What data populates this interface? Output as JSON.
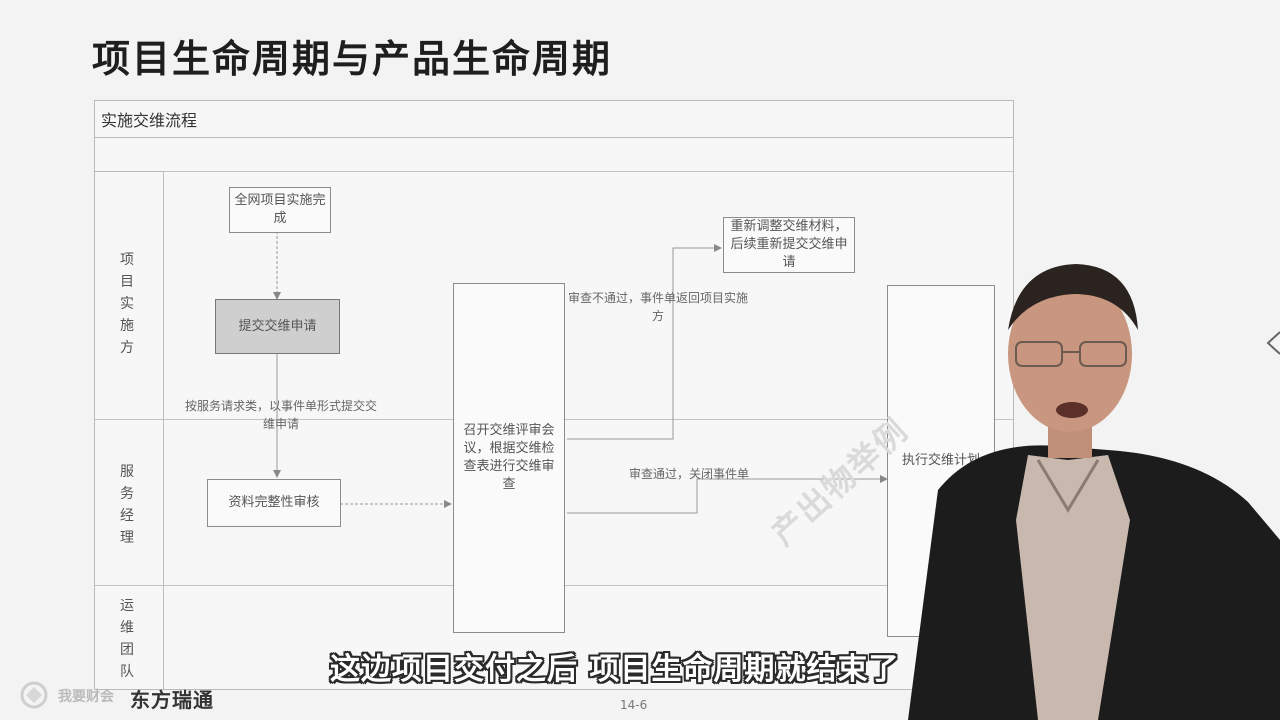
{
  "slide": {
    "title": "项目生命周期与产品生命周期",
    "page_number": "14-6"
  },
  "flow": {
    "header": "实施交维流程",
    "lanes": [
      "项目实施方",
      "服务经理",
      "运维团队"
    ],
    "boxes": {
      "project_done": "全网项目实施完成",
      "submit_request": "提交交维申请",
      "completeness_review": "资料完整性审核",
      "review_meeting": "召开交维评审会议，根据交维检查表进行交维审查",
      "readjust": "重新调整交维材料，后续重新提交交维申请",
      "execute_plan": "执行交维计划"
    },
    "notes": {
      "service_request": "按服务请求类，以事件单形式提交交维申请",
      "review_fail": "审查不通过，事件单返回项目实施方",
      "review_pass": "审查通过，关闭事件单"
    }
  },
  "watermark": "产出物举例",
  "subtitle": "这边项目交付之后 项目生命周期就结束了",
  "branding": {
    "logo_text": "我要财会",
    "company": "东方瑞通"
  },
  "colors": {
    "background": "#f3f3f3",
    "subtitle_outline": "#2a2a2a",
    "suit": "#1c1c1c"
  },
  "icons": [
    "logo-icon",
    "arrow-icon"
  ]
}
